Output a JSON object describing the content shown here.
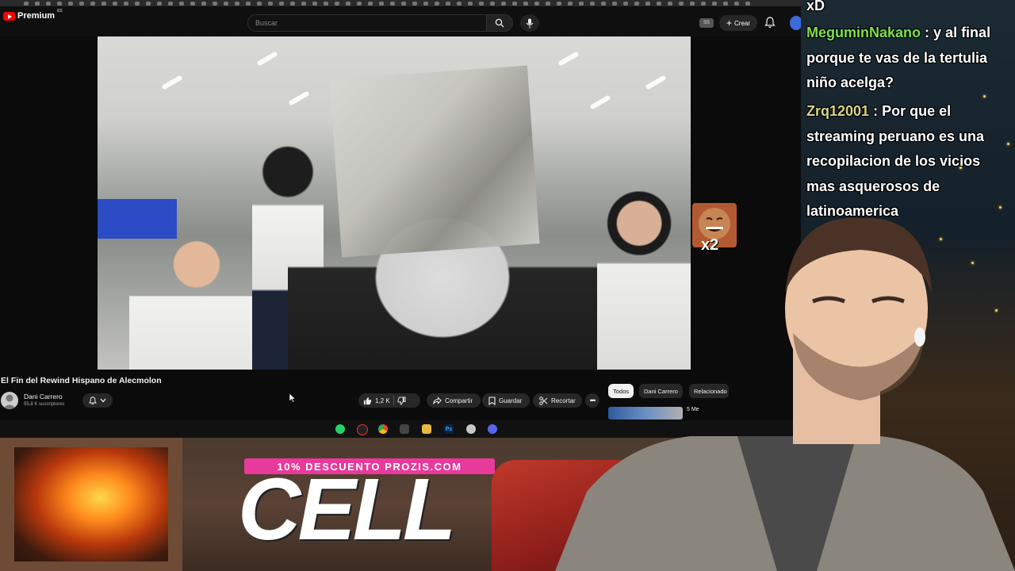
{
  "header": {
    "logo_text": "Premium",
    "logo_region": "ES",
    "search_placeholder": "Buscar",
    "badge": "SS",
    "create_label": "Crear"
  },
  "video": {
    "title": "El Fin del Rewind Hispano de Alecmolon",
    "channel_name": "Dani Carrero",
    "channel_subs": "55,8 K suscriptores",
    "likes": "1,2 K",
    "share_label": "Compartir",
    "save_label": "Guardar",
    "clip_label": "Recortar"
  },
  "chips": {
    "all": "Todos",
    "channel": "Dani Carrero",
    "related": "Relacionado"
  },
  "related": {
    "title_fragment": "5 Me"
  },
  "overlay": {
    "promo": "10% DESCUENTO PROZIS.COM",
    "brand": "CELL",
    "emote_text": "x2"
  },
  "chat": [
    {
      "user": "",
      "message": "xD"
    },
    {
      "user": "MeguminNakano",
      "message": ": y al final porque te vas de la tertulia niño acelga?"
    },
    {
      "user": "Zrq12001",
      "message": ": Por que el streaming peruano es una recopilacion de los vicios mas asquerosos de latinoamerica"
    }
  ],
  "taskbar_icons": [
    "whatsapp-icon",
    "spotify-icon",
    "chrome-icon",
    "app-icon",
    "folder-icon",
    "photoshop-icon",
    "browser-icon",
    "discord-icon"
  ],
  "colors": {
    "youtube_red": "#ff0000",
    "promo_pink": "#e83a9a",
    "chat_user_green": "#7ee04a",
    "chat_user_yellow": "#d9d486"
  }
}
